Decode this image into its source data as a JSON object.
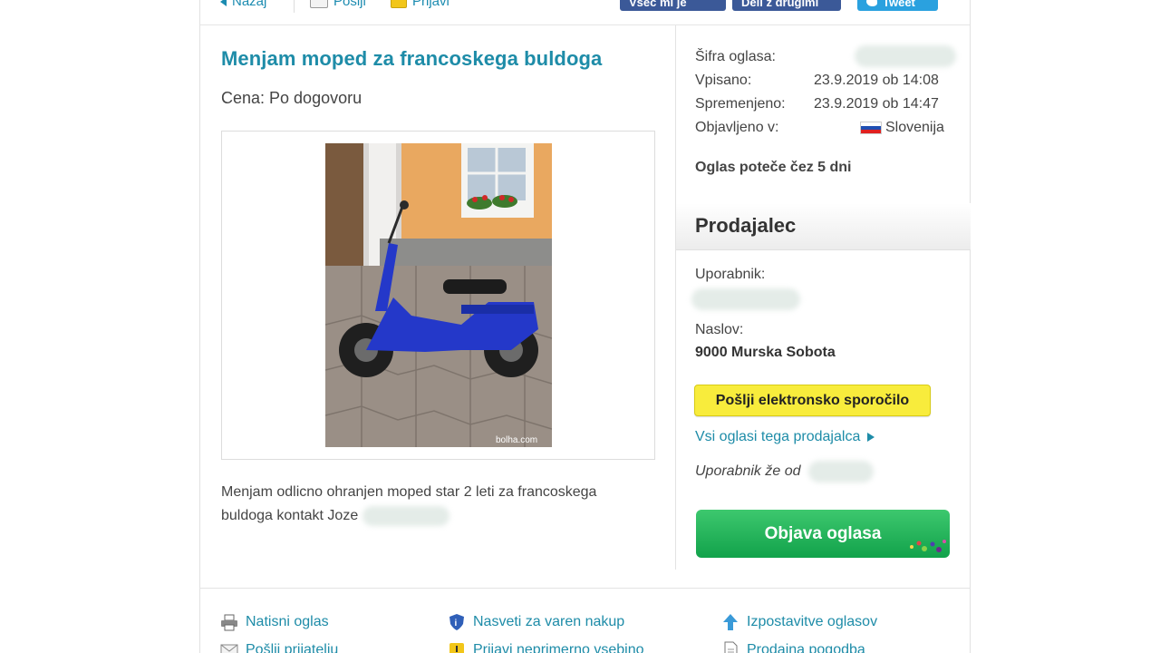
{
  "toolbar": {
    "back_label": "Nazaj",
    "send_label": "Pošlji",
    "report_label": "Prijavi",
    "share_fb_like": "Všeč mi je",
    "share_fb_share": "Deli z drugimi",
    "share_tw": "Tweet"
  },
  "ad": {
    "title": "Menjam moped za francoskega buldoga",
    "price": "Cena: Po dogovoru",
    "image_watermark": "bolha.com",
    "description": "Menjam odlicno ohranjen moped star 2 leti za francoskega buldoga kontakt Joze"
  },
  "details": {
    "code_label": "Šifra oglasa:",
    "entered_label": "Vpisano:",
    "entered_value": "23.9.2019 ob 14:08",
    "modified_label": "Spremenjeno:",
    "modified_value": "23.9.2019 ob 14:47",
    "published_label": "Objavljeno v:",
    "published_value": "Slovenija",
    "expires": "Oglas poteče čez 5 dni"
  },
  "seller": {
    "heading": "Prodajalec",
    "user_label": "Uporabnik:",
    "address_label": "Naslov:",
    "address_value": "9000 Murska Sobota",
    "message_button": "Pošlji elektronsko sporočilo",
    "all_ads_link": "Vsi oglasi tega prodajalca",
    "member_since": "Uporabnik že od",
    "post_ad_button": "Objava oglasa"
  },
  "bottom_links": {
    "print": "Natisni oglas",
    "safety": "Nasveti za varen nakup",
    "promote": "Izpostavitve oglasov",
    "send_friend": "Pošlji prijatelju",
    "report_content": "Prijavi neprimerno vsebino",
    "contract": "Prodajna pogodba"
  },
  "colors": {
    "link": "#1e8ca8",
    "message_button": "#f8ec3c",
    "post_button": "#12a24b",
    "facebook": "#3b5998",
    "twitter": "#2aa1df"
  }
}
